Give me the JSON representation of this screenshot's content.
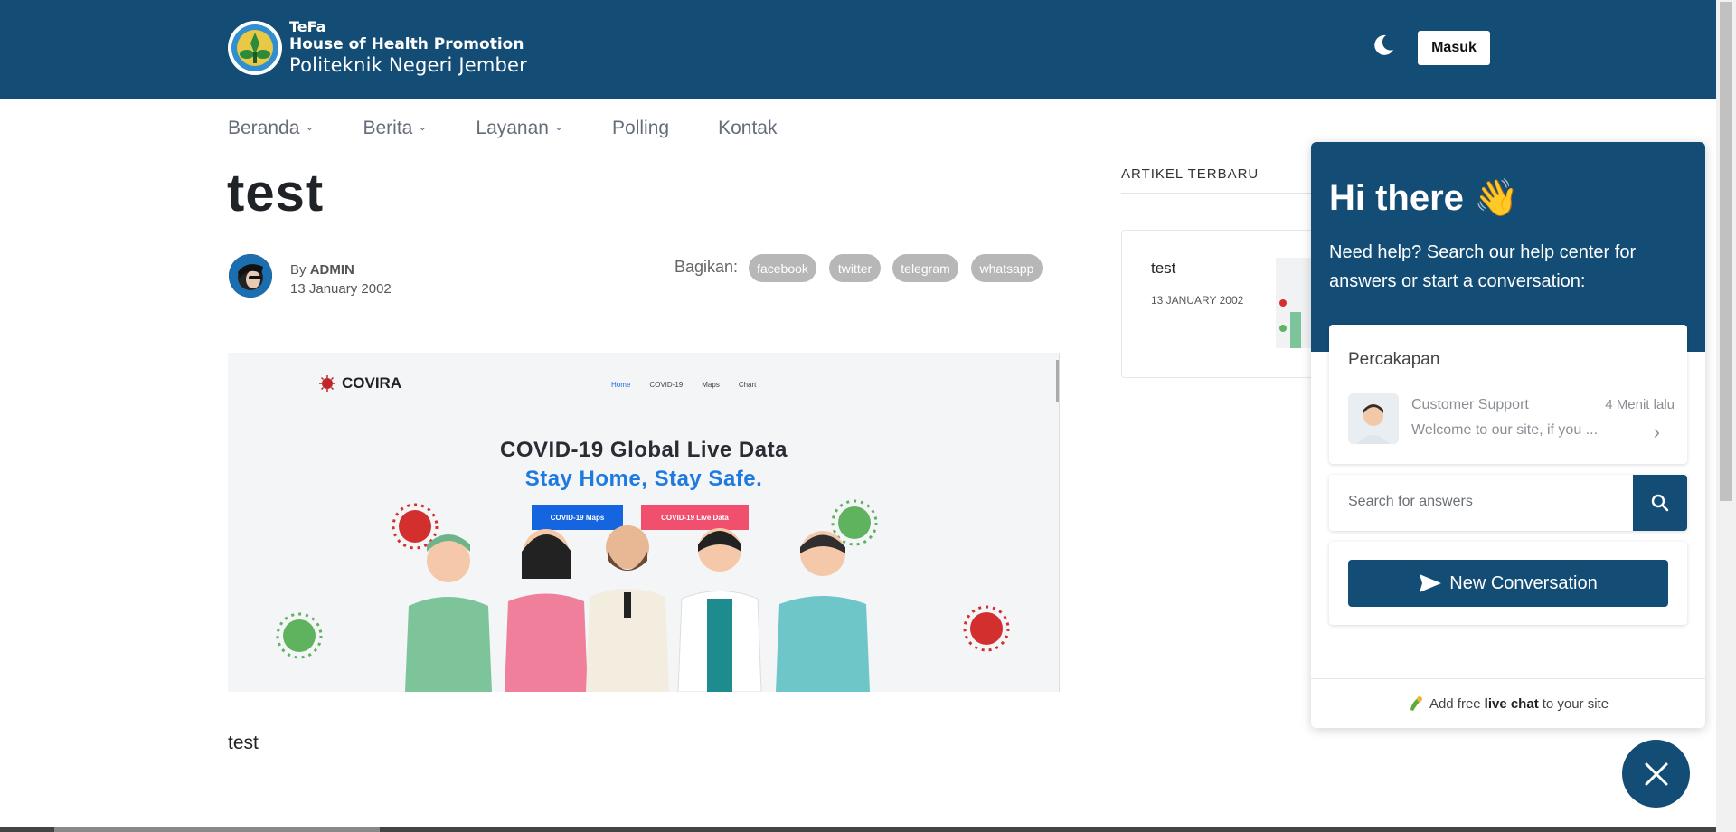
{
  "header": {
    "brand_line1": "TeFa",
    "brand_line2": "House of Health Promotion",
    "brand_line3": "Politeknik Negeri Jember",
    "login_label": "Masuk",
    "bg_color": "#134c75"
  },
  "nav": {
    "items": [
      {
        "label": "Beranda",
        "dropdown": true
      },
      {
        "label": "Berita",
        "dropdown": true
      },
      {
        "label": "Layanan",
        "dropdown": true
      },
      {
        "label": "Polling",
        "dropdown": false
      },
      {
        "label": "Kontak",
        "dropdown": false
      }
    ]
  },
  "article": {
    "title": "test",
    "by_prefix": "By",
    "author": "ADMIN",
    "date": "13 January 2002",
    "share_label": "Bagikan:",
    "share_buttons": [
      "facebook",
      "twitter",
      "telegram",
      "whatsapp"
    ],
    "body": "test",
    "hero": {
      "brand": "COVIRA",
      "nav": [
        "Home",
        "COVID-19",
        "Maps",
        "Chart"
      ],
      "headline": "COVID-19 Global Live Data",
      "subheadline": "Stay Home, Stay Safe.",
      "btn_maps": "COVID-19 Maps",
      "btn_live": "COVID-19 Live Data"
    }
  },
  "sidebar": {
    "heading": "ARTIKEL TERBARU",
    "posts": [
      {
        "title": "test",
        "date": "13 JANUARY 2002"
      }
    ]
  },
  "chat": {
    "greeting": "Hi there 👋",
    "intro": "Need help? Search our help center for answers or start a conversation:",
    "conversations_title": "Percakapan",
    "agent_name": "Customer Support",
    "agent_time": "4 Menit lalu",
    "agent_message": "Welcome to our site, if you ...",
    "search_placeholder": "Search for answers",
    "new_conversation": "New Conversation",
    "footer_prefix": "Add free",
    "footer_bold": "live chat",
    "footer_suffix": "to your site",
    "accent_color": "#134c75"
  }
}
